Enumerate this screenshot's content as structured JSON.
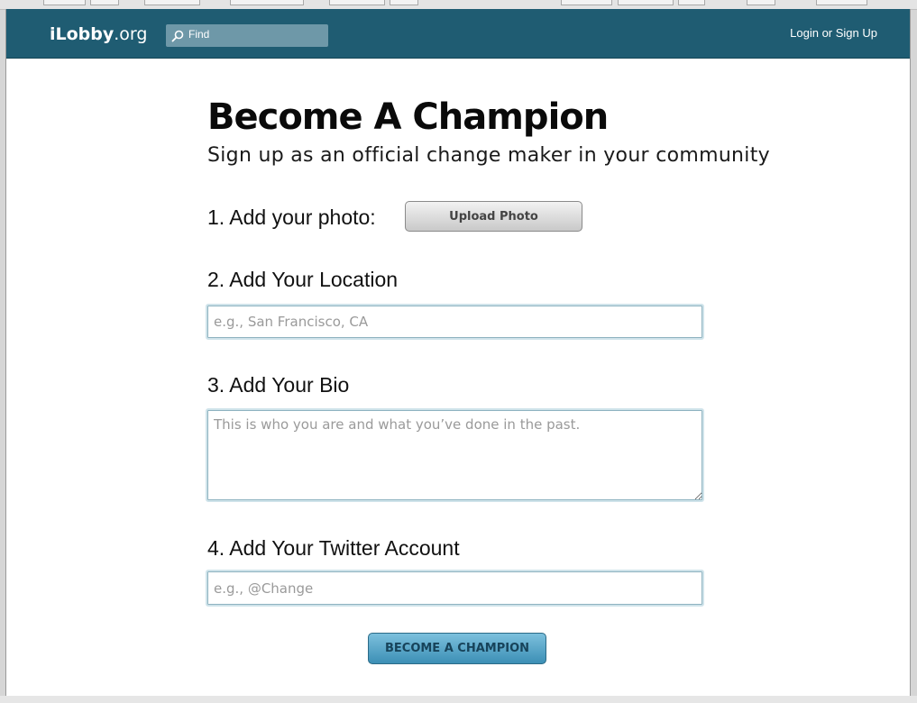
{
  "nav": {
    "logo_bold": "iLobby",
    "logo_suffix": ".org",
    "search_label": "Find",
    "login_label": "Login or Sign Up"
  },
  "header": {
    "title": "Become A Champion",
    "subtitle": "Sign up as an official change maker in your community"
  },
  "form": {
    "photo": {
      "label": "1. Add your photo:",
      "button": "Upload Photo"
    },
    "location": {
      "label": "2. Add Your Location",
      "placeholder": "e.g., San Francisco, CA"
    },
    "bio": {
      "label": "3. Add Your Bio",
      "placeholder": "This is who you are and what you’ve done in the past."
    },
    "twitter": {
      "label": "4. Add Your Twitter Account",
      "placeholder": "e.g., @Change"
    },
    "submit": "BECOME A CHAMPION"
  },
  "colors": {
    "navbar": "#1f5c72",
    "search_box": "#6e98a8",
    "submit": "#4a9cc2"
  }
}
